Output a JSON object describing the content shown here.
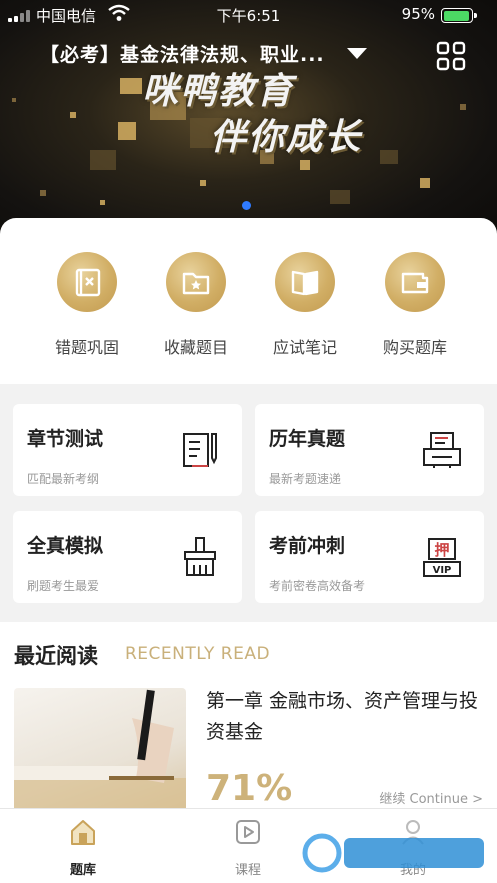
{
  "status_bar": {
    "carrier": "中国电信",
    "time": "下午6:51",
    "battery": "95%",
    "battery_level": 0.95
  },
  "header": {
    "course": "【必考】基金法律法规、职业...",
    "menu_icon": "grid-icon"
  },
  "banner": {
    "line1": "咪鸭教育",
    "line2": "伴你成长",
    "slide_count": 1,
    "active_slide": 0
  },
  "quick_actions": [
    {
      "label": "错题巩固",
      "icon": "wrong-questions-icon"
    },
    {
      "label": "收藏题目",
      "icon": "favorites-folder-icon"
    },
    {
      "label": "应试笔记",
      "icon": "notebook-icon"
    },
    {
      "label": "购买题库",
      "icon": "wallet-icon"
    }
  ],
  "test_cards": [
    {
      "title": "章节测试",
      "subtitle": "匹配最新考纲",
      "icon": "chapter-test-icon"
    },
    {
      "title": "历年真题",
      "subtitle": "最新考题速递",
      "icon": "past-papers-icon"
    },
    {
      "title": "全真模拟",
      "subtitle": "刷题考生最爱",
      "icon": "mock-exam-icon"
    },
    {
      "title": "考前冲刺",
      "subtitle": "考前密卷高效备考",
      "icon": "vip-sprint-icon",
      "badge_char": "押",
      "badge_text": "VIP"
    }
  ],
  "recent": {
    "title": "最近阅读",
    "subtitle": "RECENTLY READ",
    "book_title": "第一章 金融市场、资产管理与投资基金",
    "progress": "71%",
    "continue_label": "继续 Continue >"
  },
  "tabbar": {
    "tabs": [
      {
        "label": "题库",
        "icon": "question-bank-icon",
        "active": true
      },
      {
        "label": "课程",
        "icon": "course-play-icon",
        "active": false
      },
      {
        "label": "我的",
        "icon": "profile-icon",
        "active": false
      }
    ]
  },
  "colors": {
    "gold": "#d1ae65",
    "accent_text": "#c9b07a",
    "active_dot": "#2f7bff",
    "battery": "#4cd964"
  }
}
